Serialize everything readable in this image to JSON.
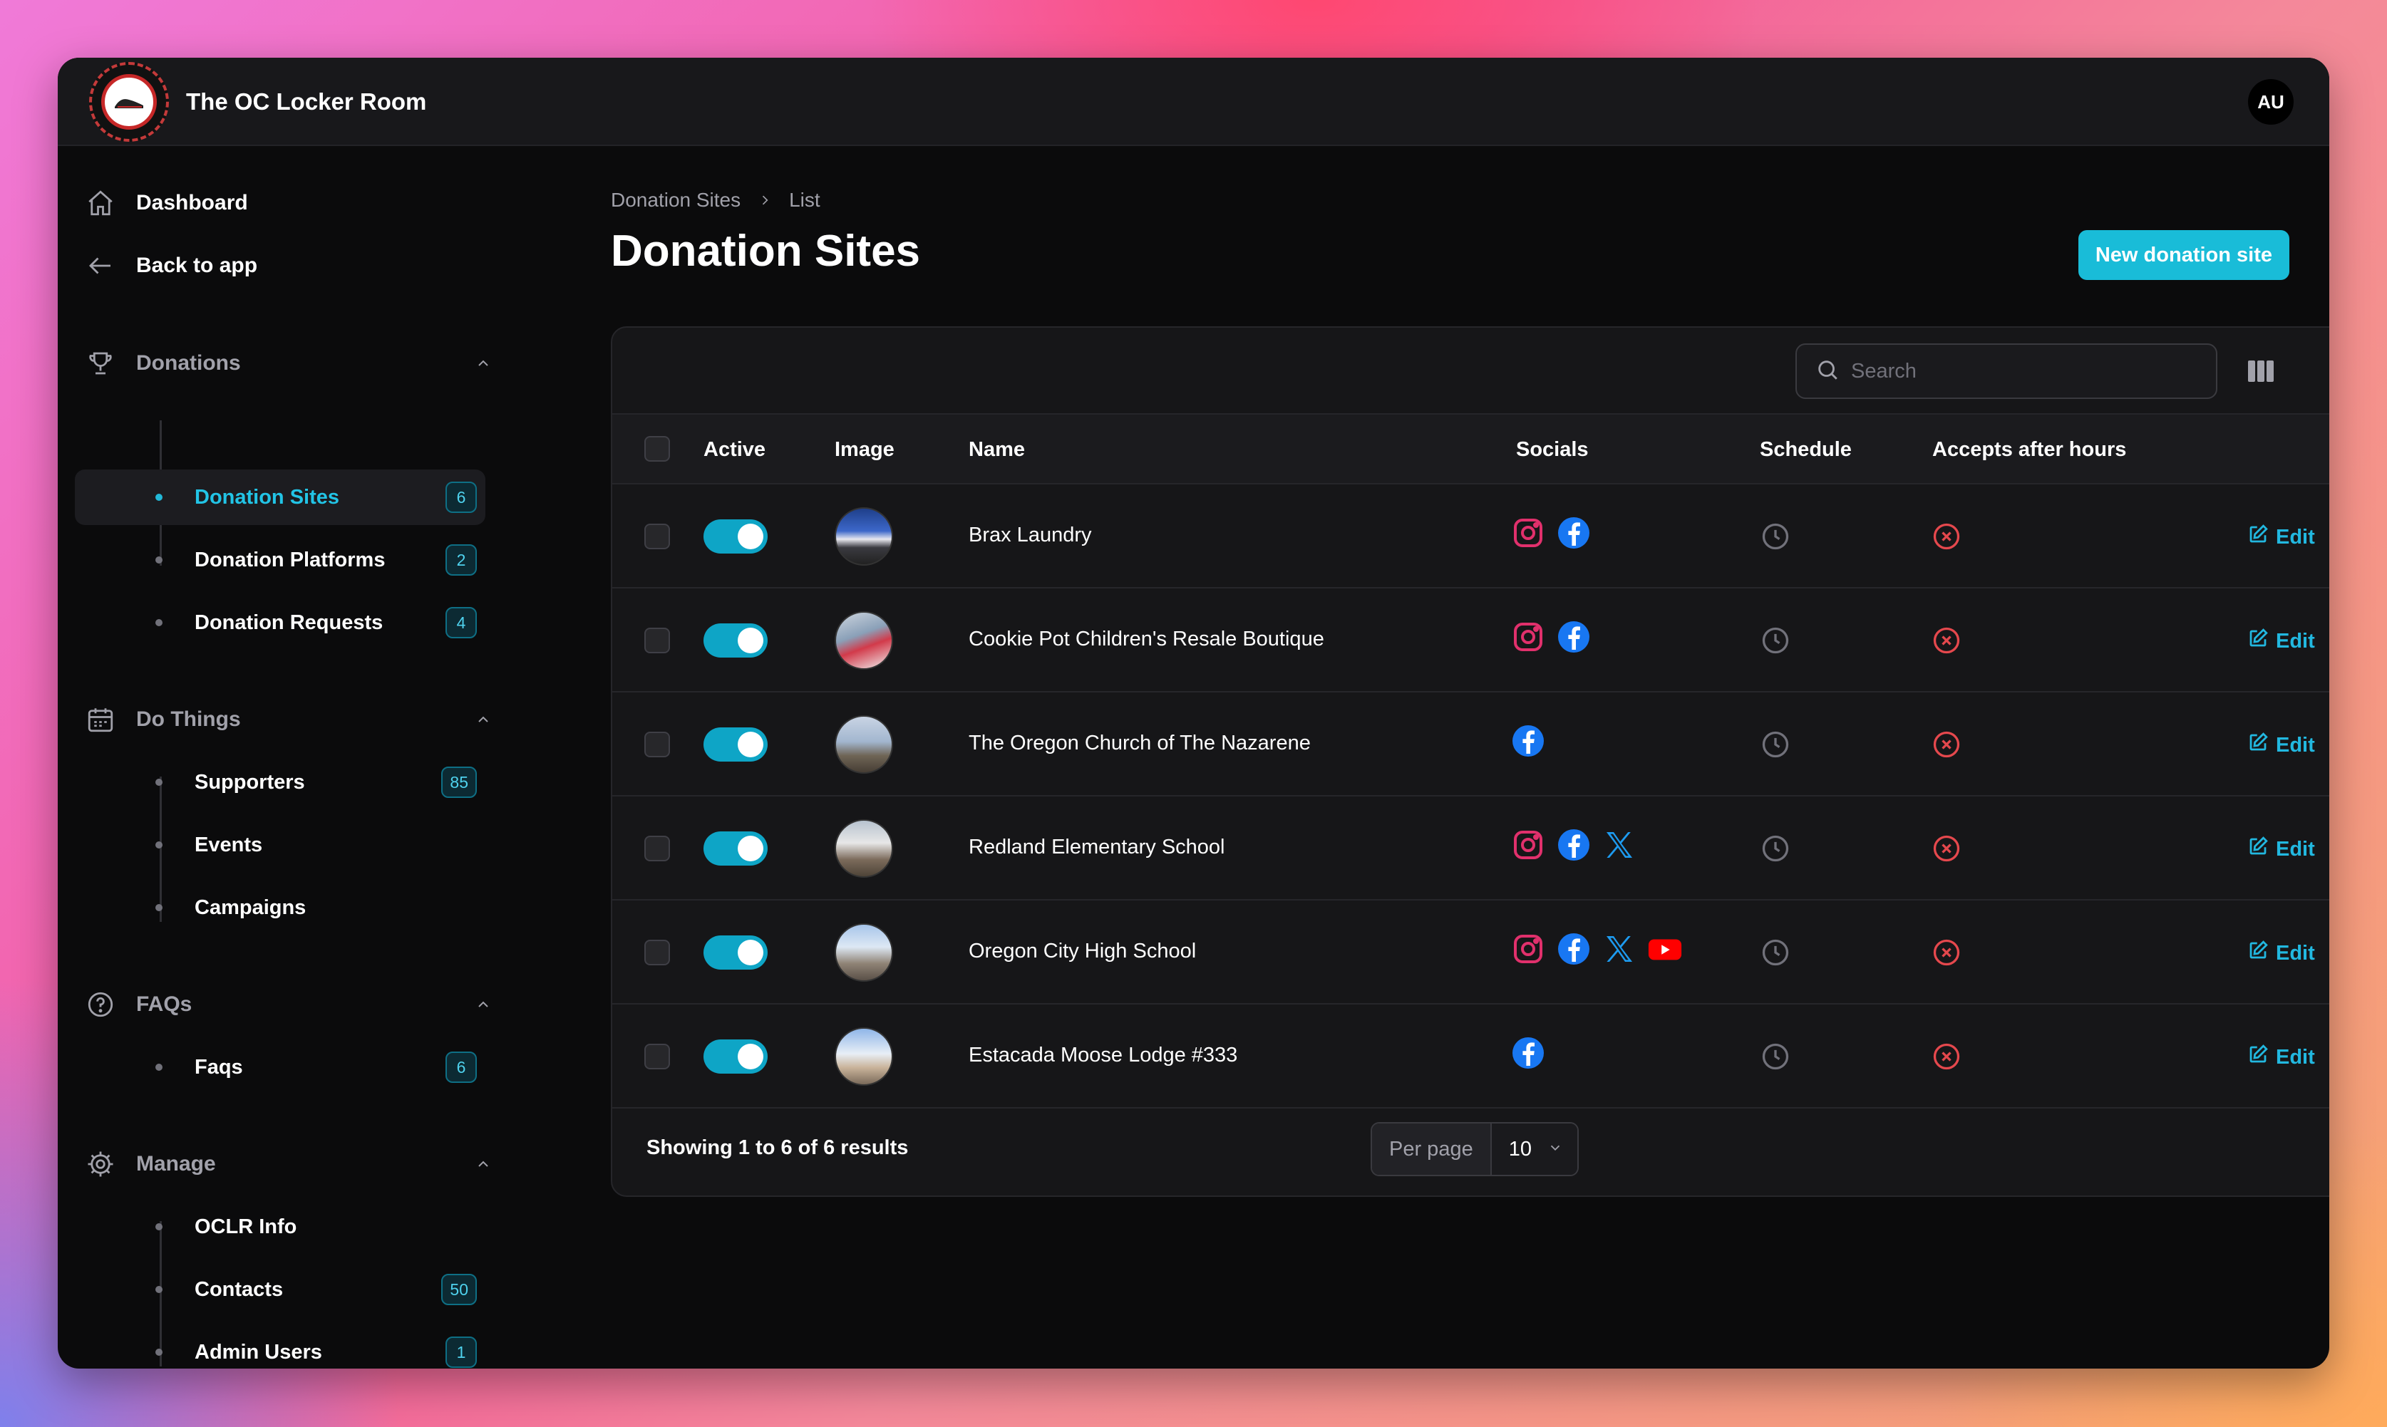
{
  "app": {
    "title": "The OC Locker Room",
    "avatar_initials": "AU"
  },
  "sidebar": {
    "top": [
      {
        "label": "Dashboard",
        "icon": "home-icon"
      },
      {
        "label": "Back to app",
        "icon": "arrow-left-icon"
      }
    ],
    "groups": [
      {
        "label": "Donations",
        "icon": "trophy-icon",
        "items": [
          {
            "label": "Donation Sites",
            "badge": "6",
            "active": true
          },
          {
            "label": "Donation Platforms",
            "badge": "2"
          },
          {
            "label": "Donation Requests",
            "badge": "4"
          }
        ]
      },
      {
        "label": "Do Things",
        "icon": "calendar-icon",
        "items": [
          {
            "label": "Supporters",
            "badge": "85"
          },
          {
            "label": "Events"
          },
          {
            "label": "Campaigns"
          }
        ]
      },
      {
        "label": "FAQs",
        "icon": "question-circle-icon",
        "items": [
          {
            "label": "Faqs",
            "badge": "6"
          }
        ]
      },
      {
        "label": "Manage",
        "icon": "cog-icon",
        "items": [
          {
            "label": "OCLR Info"
          },
          {
            "label": "Contacts",
            "badge": "50"
          },
          {
            "label": "Admin Users",
            "badge": "1"
          }
        ]
      }
    ]
  },
  "breadcrumb": [
    "Donation Sites",
    "List"
  ],
  "page": {
    "title": "Donation Sites",
    "new_button": "New donation site"
  },
  "table": {
    "search_placeholder": "Search",
    "columns": [
      "Active",
      "Image",
      "Name",
      "Socials",
      "Schedule",
      "Accepts after hours"
    ],
    "edit_label": "Edit",
    "rows": [
      {
        "name": "Brax Laundry",
        "active": true,
        "socials": [
          "instagram",
          "facebook"
        ]
      },
      {
        "name": "Cookie Pot Children's Resale Boutique",
        "active": true,
        "socials": [
          "instagram",
          "facebook"
        ]
      },
      {
        "name": "The Oregon Church of The Nazarene",
        "active": true,
        "socials": [
          "facebook"
        ]
      },
      {
        "name": "Redland Elementary School",
        "active": true,
        "socials": [
          "instagram",
          "facebook",
          "x"
        ]
      },
      {
        "name": "Oregon City High School",
        "active": true,
        "socials": [
          "instagram",
          "facebook",
          "x",
          "youtube"
        ]
      },
      {
        "name": "Estacada Moose Lodge #333",
        "active": true,
        "socials": [
          "facebook"
        ]
      }
    ],
    "footer": {
      "showing": "Showing 1 to 6 of 6 results",
      "per_page_label": "Per page",
      "per_page_value": "10"
    }
  },
  "colors": {
    "accent": "#19bcd8",
    "instagram": "#e1306c",
    "facebook": "#1877f2",
    "x": "#1d9bf0",
    "youtube": "#ff0000",
    "danger": "#e5484d"
  }
}
